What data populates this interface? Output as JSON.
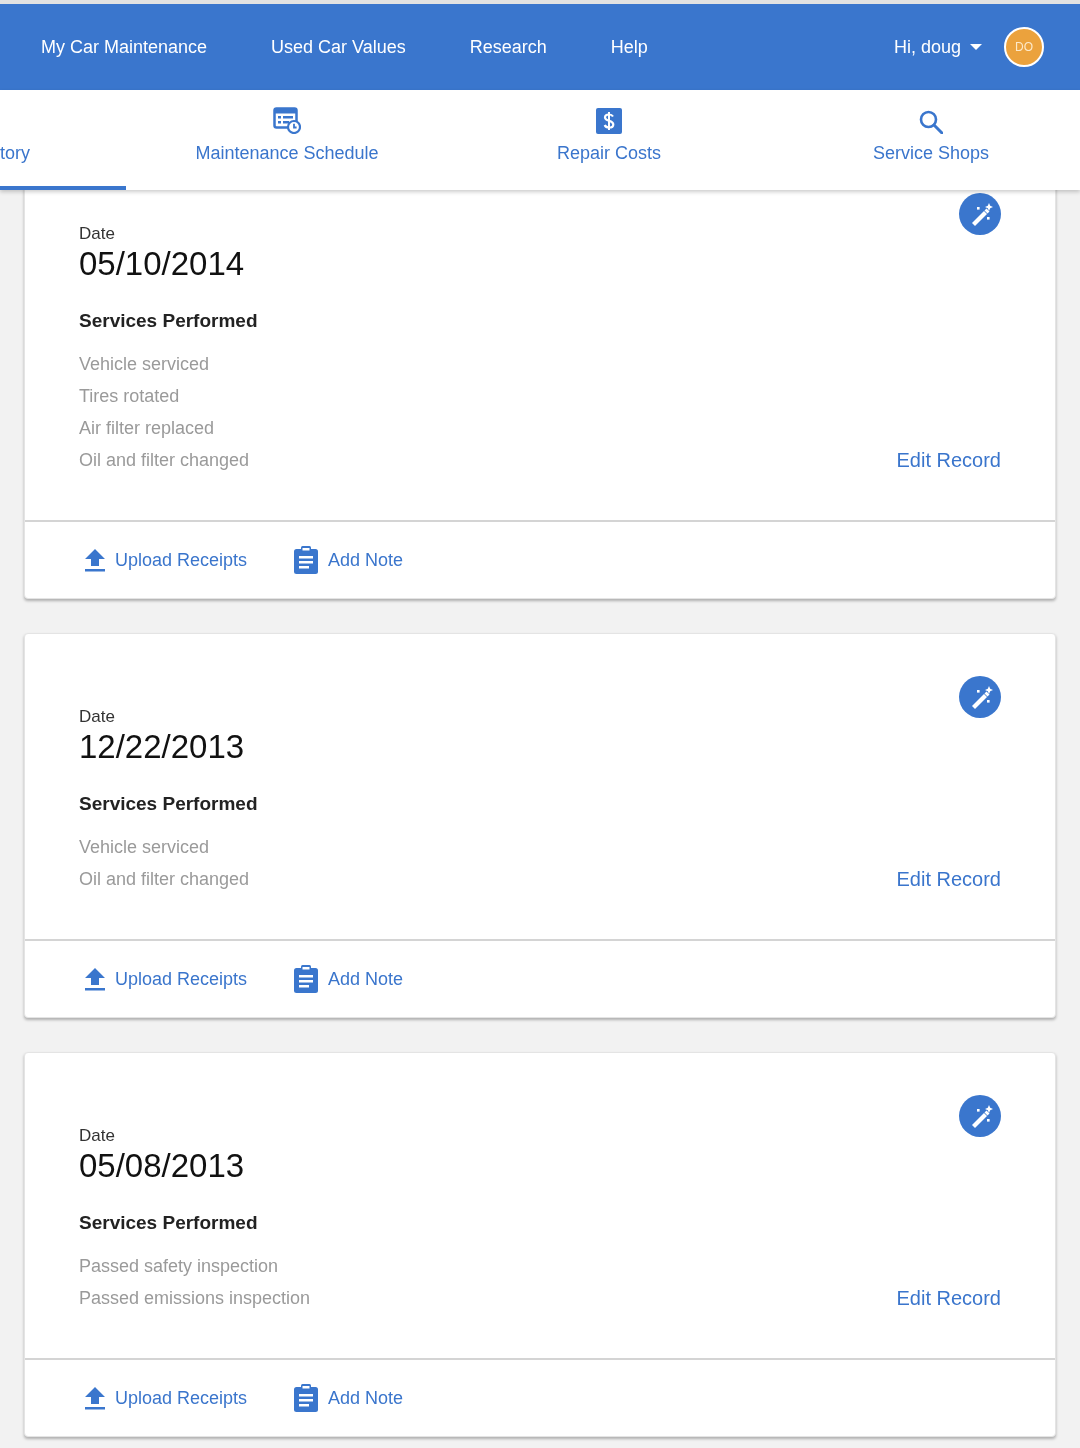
{
  "nav": {
    "links": [
      {
        "label": "My Car Maintenance"
      },
      {
        "label": "Used Car Values"
      },
      {
        "label": "Research"
      },
      {
        "label": "Help"
      }
    ],
    "user": {
      "greeting": "Hi, doug",
      "initials": "DO"
    }
  },
  "tabs": [
    {
      "label": "tory",
      "selected": true
    },
    {
      "label": "Maintenance Schedule",
      "selected": false
    },
    {
      "label": "Repair Costs",
      "selected": false
    },
    {
      "label": "Service Shops",
      "selected": false
    }
  ],
  "records": [
    {
      "date_label": "Date",
      "date": "05/10/2014",
      "services_heading": "Services Performed",
      "services": [
        "Vehicle serviced",
        "Tires rotated",
        "Air filter replaced",
        "Oil and filter changed"
      ],
      "edit": "Edit Record",
      "actions": [
        "Upload Receipts",
        "Add Note"
      ]
    },
    {
      "date_label": "Date",
      "date": "12/22/2013",
      "services_heading": "Services Performed",
      "services": [
        "Vehicle serviced",
        "Oil and filter changed"
      ],
      "edit": "Edit Record",
      "actions": [
        "Upload Receipts",
        "Add Note"
      ]
    },
    {
      "date_label": "Date",
      "date": "05/08/2013",
      "services_heading": "Services Performed",
      "services": [
        "Passed safety inspection",
        "Passed emissions inspection"
      ],
      "edit": "Edit Record",
      "actions": [
        "Upload Receipts",
        "Add Note"
      ]
    }
  ]
}
